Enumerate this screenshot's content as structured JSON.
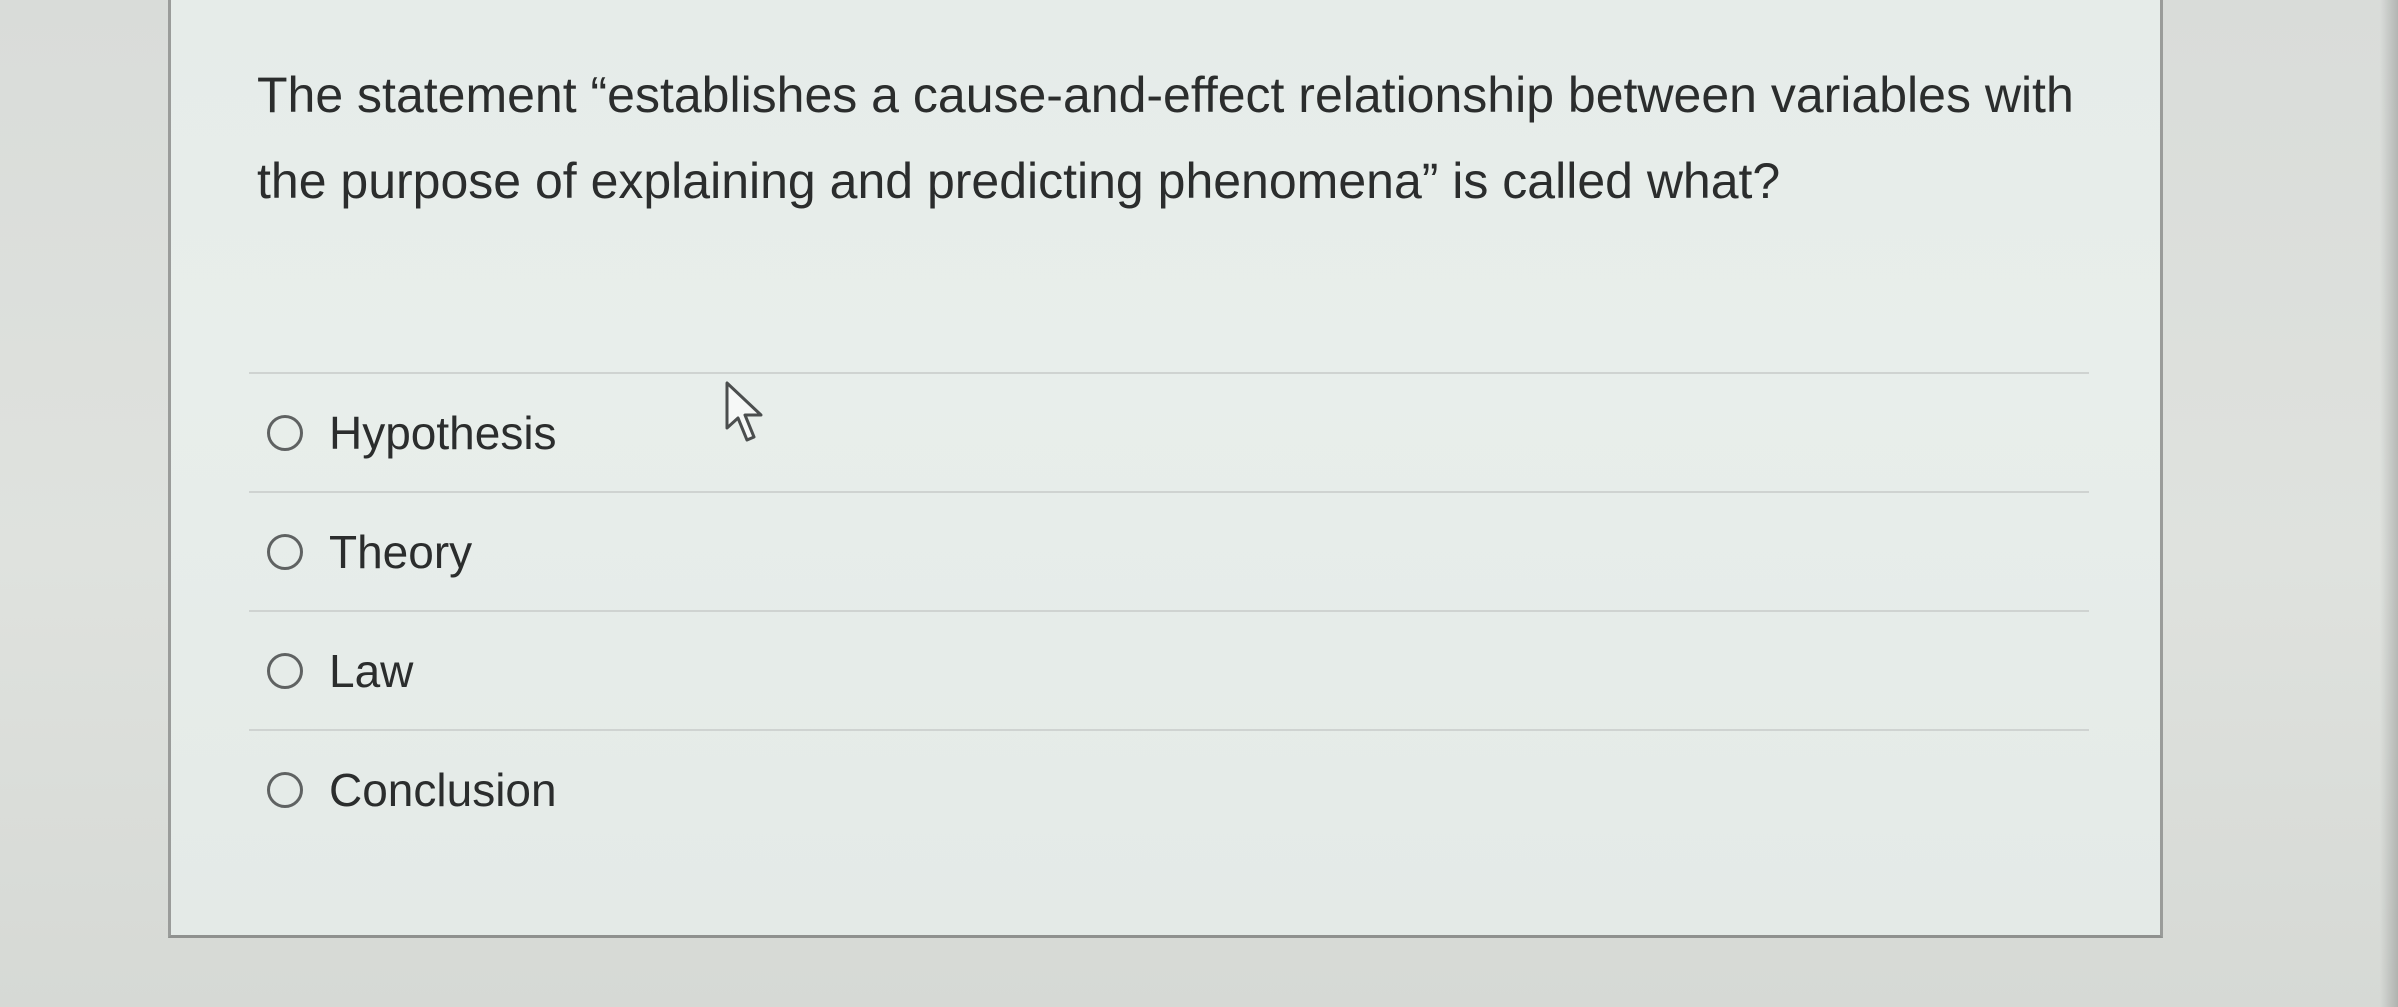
{
  "question": {
    "text": "The statement “establishes a cause-and-effect relationship between variables with the purpose of explaining and predicting phenomena” is called what?"
  },
  "choices": [
    {
      "label": "Hypothesis"
    },
    {
      "label": "Theory"
    },
    {
      "label": "Law"
    },
    {
      "label": "Conclusion"
    }
  ],
  "icons": {
    "radio": "radio-unselected-icon",
    "cursor": "mouse-pointer-icon"
  }
}
